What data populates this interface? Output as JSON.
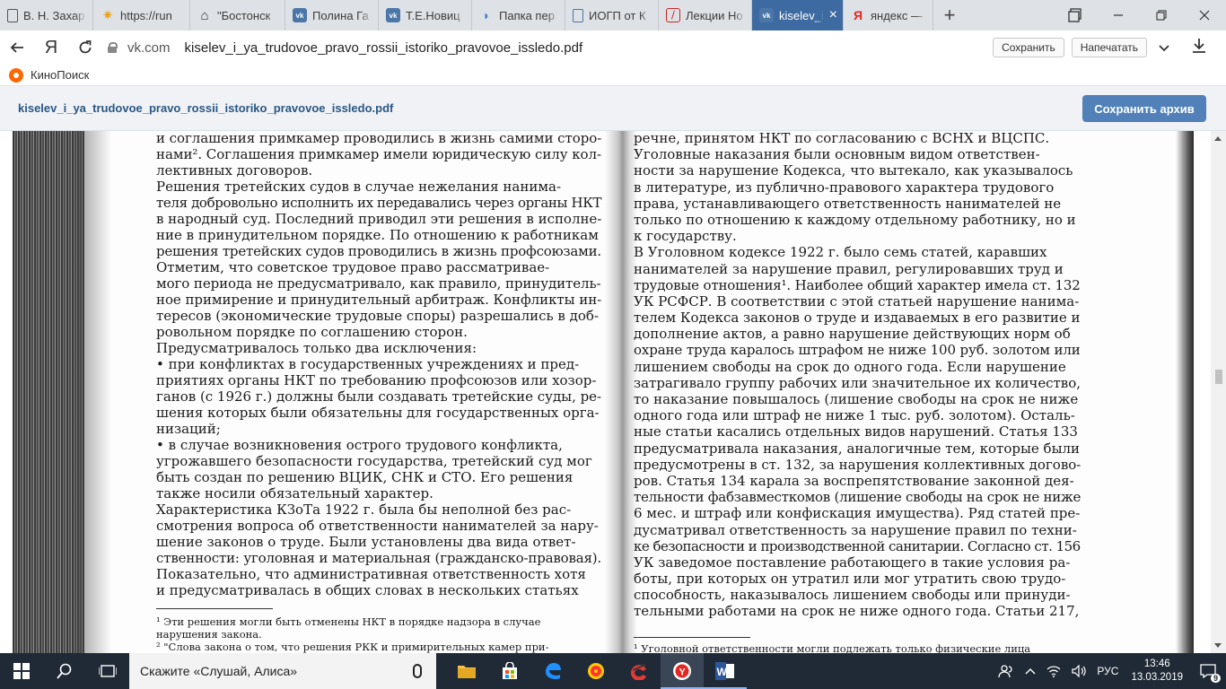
{
  "browser": {
    "tabs": [
      {
        "label": "В. Н. Захар",
        "icon": "doc-icon",
        "color": "#555555"
      },
      {
        "label": "https://run",
        "icon": "sun-icon",
        "color": "#e8a317"
      },
      {
        "label": "\"Бостонск",
        "icon": "building-icon",
        "color": "#333333"
      },
      {
        "label": "Полина Га",
        "icon": "vk-icon",
        "color": "#4a76a8"
      },
      {
        "label": "Т.Е.Новиц",
        "icon": "vk-icon",
        "color": "#4a76a8"
      },
      {
        "label": "Папка пер",
        "icon": "cloud-icon",
        "color": "#3b82c4"
      },
      {
        "label": "ИОГП от К",
        "icon": "doc-icon",
        "color": "#4a76a8"
      },
      {
        "label": "Лекции Но",
        "icon": "pdf-icon",
        "color": "#c62828"
      },
      {
        "label": "kiselev_i",
        "icon": "vk-icon",
        "color": "#4a76a8",
        "active": true
      },
      {
        "label": "яндекс — ",
        "icon": "yandex-icon",
        "color": "#e52620"
      }
    ],
    "new_tab": "+",
    "address": {
      "host": "vk.com",
      "path": "kiselev_i_ya_trudovoe_pravo_rossii_istoriko_pravovoe_issledo.pdf"
    },
    "save_label": "Сохранить",
    "print_label": "Напечатать",
    "bookmark": "КиноПоиск"
  },
  "doc": {
    "filename": "kiselev_i_ya_trudovoe_pravo_rossii_istoriko_pravovoe_issledo.pdf",
    "save_archive": "Сохранить архив"
  },
  "left_page": [
    "и соглашения примкамер проводились в жизнь самими сторо-",
    "нами². Соглашения примкамер имели юридическую силу кол-",
    "лективных договоров.",
    "    Решения третейских судов в случае нежелания нанима-",
    "теля добровольно исполнить их передавались через органы НКТ",
    "в народный суд. Последний приводил эти решения в исполне-",
    "ние в принудительном порядке. По отношению к работникам",
    "решения третейских судов проводились в жизнь профсоюзами.",
    "    Отметим, что советское трудовое право рассматривае-",
    "мого периода не предусматривало, как правило, принудитель-",
    "ное примирение и принудительный арбитраж. Конфликты ин-",
    "тересов (экономические трудовые споры) разрешались в доб-",
    "ровольном порядке по соглашению сторон.",
    "    Предусматривалось только два исключения:",
    "    • при конфликтах в государственных учреждениях и пред-",
    "приятиях органы НКТ по требованию профсоюзов или хозор-",
    "ганов (с 1926 г.) должны были создавать третейские суды, ре-",
    "шения которых были обязательны для государственных орга-",
    "низаций;",
    "    • в случае возникновения острого трудового конфликта,",
    "угрожавшего безопасности государства, третейский суд мог",
    "быть создан по решению ВЦИК, СНК и СТО. Его решения",
    "также носили обязательный характер.",
    "    Характеристика КЗоТа 1922 г. была бы неполной без рас-",
    "смотрения вопроса об ответственности нанимателей за нару-",
    "шение законов о труде. Были установлены два вида ответ-",
    "ственности: уголовная и материальная (гражданско-правовая).",
    "    Показательно, что административная ответственность хотя",
    "и предусматривалась в общих словах в нескольких статьях"
  ],
  "left_footnotes": [
    "¹ Эти решения могли быть отменены НКТ в порядке надзора в случае",
    "нарушения закона.",
    "² \"Слова закона о том, что решения РКК и примирительных камер при-"
  ],
  "right_page": [
    "речне, принятом НКТ по согласованию с ВСНХ и ВЦСПС.",
    "    Уголовные наказания были основным видом ответствен-",
    "ности за нарушение Кодекса, что вытекало, как указывалось",
    "в литературе, из публично-правового характера трудового",
    "права, устанавливающего ответственность нанимателей не",
    "только по отношению к каждому отдельному работнику, но и",
    "к государству.",
    "    В Уголовном кодексе 1922 г. было семь статей, каравших",
    "нанимателей за нарушение правил, регулировавших труд и",
    "трудовые отношения¹. Наиболее общий характер имела ст. 132",
    "УК РСФСР. В соответствии с этой статьей нарушение нанима-",
    "телем Кодекса законов о труде и издаваемых в его развитие и",
    "дополнение актов, а равно нарушение действующих норм об",
    "охране труда каралось штрафом не ниже 100 руб. золотом или",
    "лишением свободы на срок до одного года. Если нарушение",
    "затрагивало группу рабочих или значительное их количество,",
    "то наказание повышалось (лишение свободы на срок не ниже",
    "одного года или штраф не ниже 1 тыс. руб. золотом). Осталь-",
    "ные статьи касались отдельных видов нарушений. Статья 133",
    "предусматривала наказания, аналогичные тем, которые были",
    "предусмотрены в ст. 132, за нарушения коллективных догово-",
    "ров. Статья 134 карала за воспрепятствование законной дея-",
    "тельности фабзавместкомов (лишение свободы на срок не ниже",
    "6 мес. и штраф или конфискация имущества). Ряд статей пре-",
    "дусматривал ответственность за нарушение правил по техни-",
    "ке безопасности и производственной санитарии. Согласно ст. 156",
    "УК заведомое поставление работающего в такие условия ра-",
    "боты, при которых он утратил или мог утратить свою трудо-",
    "способность, наказывалось лишением свободы или принуди-",
    "тельными работами на срок не ниже одного года. Статьи 217,"
  ],
  "right_footnotes": [
    "¹ Уголовной ответственности могли подлежать только физические лица"
  ],
  "taskbar": {
    "search_placeholder": "Скажите «Слушай, Алиса»",
    "lang": "РУС",
    "time": "13:46",
    "date": "13.03.2019",
    "notif_count": "9"
  },
  "colors": {
    "active_tab": "#3d6aa0",
    "vk_blue": "#5181b8",
    "link": "#2a5885",
    "cursor_red": "#e53935",
    "taskbar": "#1f2a36"
  }
}
